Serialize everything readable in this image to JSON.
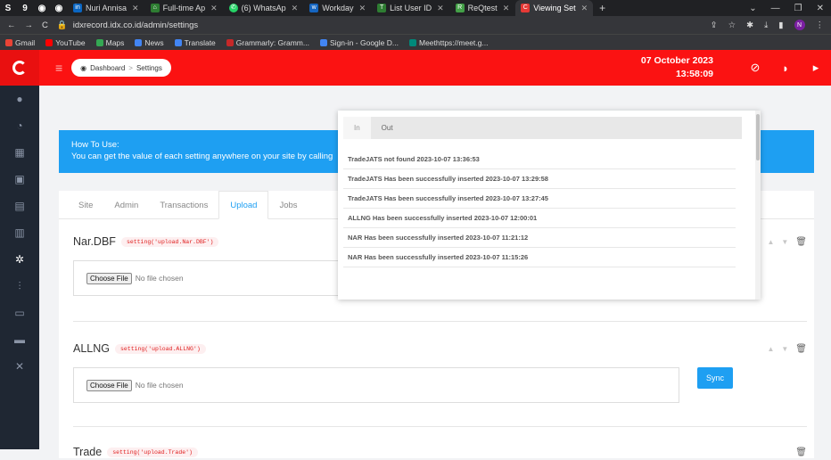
{
  "browser": {
    "tabs": [
      {
        "label": "Nuri Annisa",
        "icon": "linkedin-icon",
        "color": "#0a66c2"
      },
      {
        "label": "Full-time Ap",
        "icon": "job-icon",
        "color": "#2e7d32"
      },
      {
        "label": "(6) WhatsAp",
        "icon": "whatsapp-icon",
        "color": "#25d366"
      },
      {
        "label": "Workday",
        "icon": "workday-icon",
        "color": "#1565c0"
      },
      {
        "label": "List User ID",
        "icon": "list-icon",
        "color": "#2e7d32"
      },
      {
        "label": "ReQtest",
        "icon": "reqtest-icon",
        "color": "#43a047"
      },
      {
        "label": "Viewing Set",
        "icon": "page-icon",
        "color": "#e53935",
        "active": true
      }
    ],
    "url": "idxrecord.idx.co.id/admin/settings",
    "profile_initial": "N",
    "bookmarks": [
      "Gmail",
      "YouTube",
      "Maps",
      "News",
      "Translate",
      "Grammarly: Gramm...",
      "Sign-in - Google D...",
      "Meethttps://meet.g..."
    ]
  },
  "sidebar": {
    "items": [
      "home-icon",
      "dashboard-icon",
      "chart-icon",
      "box-icon",
      "document-icon",
      "file-icon",
      "gear-icon",
      "sliders-icon",
      "window-icon",
      "folder-icon",
      "tools-icon"
    ]
  },
  "header": {
    "breadcrumb_home": "Dashboard",
    "breadcrumb_separator": ">",
    "breadcrumb_current": "Settings",
    "date": "07 October 2023",
    "time": "13:58:09"
  },
  "howto": {
    "title": "How To Use:",
    "text": "You can get the value of each setting anywhere on your site by calling"
  },
  "settings_tabs": [
    "Site",
    "Admin",
    "Transactions",
    "Upload",
    "Jobs"
  ],
  "active_tab": "Upload",
  "sections": [
    {
      "name": "Nar.DBF",
      "code": "setting('upload.Nar.DBF')",
      "button": "Choose File",
      "status": "No file chosen"
    },
    {
      "name": "ALLNG",
      "code": "setting('upload.ALLNG')",
      "button": "Choose File",
      "status": "No file chosen",
      "sync": "Sync"
    },
    {
      "name": "Trade",
      "code": "setting('upload.Trade')"
    }
  ],
  "notifications": {
    "tabs": [
      "In",
      "Out"
    ],
    "items": [
      "TradeJATS not found 2023-10-07 13:36:53",
      "TradeJATS Has been successfully inserted 2023-10-07 13:29:58",
      "TradeJATS Has been successfully inserted 2023-10-07 13:27:45",
      "ALLNG Has been successfully inserted 2023-10-07 12:00:01",
      "NAR Has been successfully inserted 2023-10-07 11:21:12",
      "NAR Has been successfully inserted 2023-10-07 11:15:26"
    ]
  }
}
